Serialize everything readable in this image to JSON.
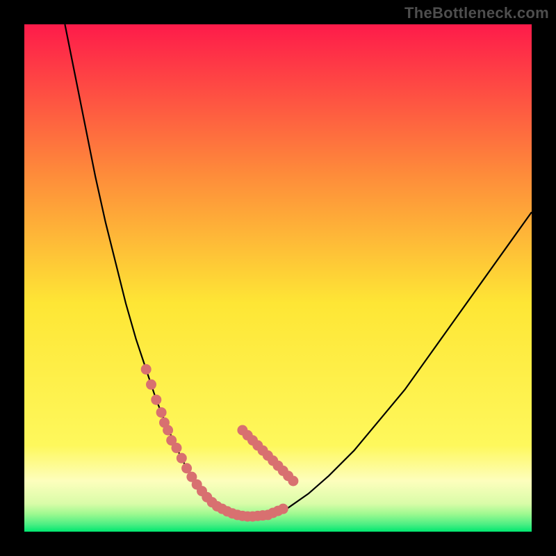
{
  "attribution": "TheBottleneck.com",
  "colors": {
    "frame": "#000000",
    "grad_top": "#fe1b4a",
    "grad_mid_upper": "#fe8d3a",
    "grad_mid": "#fee635",
    "grad_low": "#fdfebd",
    "grad_bottom1": "#9ef990",
    "grad_bottom2": "#00e770",
    "curve": "#000000",
    "marker": "#d87070"
  },
  "chart_data": {
    "type": "line",
    "title": "",
    "xlabel": "",
    "ylabel": "",
    "xlim": [
      0,
      100
    ],
    "ylim": [
      0,
      100
    ],
    "series": [
      {
        "name": "bottleneck-curve",
        "x": [
          8,
          10,
          12,
          14,
          16,
          18,
          20,
          22,
          24,
          26,
          28,
          30,
          32,
          33,
          34,
          35,
          36,
          37,
          38,
          40,
          42,
          45,
          48,
          52,
          56,
          60,
          65,
          70,
          75,
          80,
          85,
          90,
          95,
          100
        ],
        "y": [
          100,
          90,
          80,
          70,
          61,
          53,
          45,
          38,
          32,
          26,
          21,
          16.5,
          12.5,
          10.8,
          9.3,
          8,
          6.8,
          5.8,
          5,
          4,
          3.3,
          3,
          3.3,
          4.7,
          7.5,
          11,
          16,
          22,
          28,
          35,
          42,
          49,
          56,
          63
        ]
      }
    ],
    "markers": {
      "name": "highlighted-segment",
      "x": [
        24,
        25,
        26,
        27,
        27.6,
        28.3,
        29,
        30,
        31,
        32,
        33,
        34,
        35,
        36,
        37,
        38,
        39,
        40,
        41,
        42,
        43,
        44,
        45,
        46,
        47,
        48,
        49,
        50,
        51
      ],
      "y": [
        32,
        29,
        26,
        23.5,
        21.5,
        20,
        18,
        16.5,
        14.5,
        12.5,
        10.8,
        9.3,
        8,
        6.8,
        5.8,
        5,
        4.5,
        4,
        3.6,
        3.3,
        3.1,
        3,
        3,
        3.1,
        3.2,
        3.3,
        3.7,
        4.1,
        4.5
      ],
      "extra_clusters": [
        {
          "x": [
            43,
            44,
            45,
            46,
            47,
            48,
            49,
            50,
            51,
            52,
            53
          ],
          "y": [
            20,
            19,
            18,
            17,
            16,
            15,
            14,
            13,
            12,
            11,
            10
          ]
        }
      ]
    }
  }
}
